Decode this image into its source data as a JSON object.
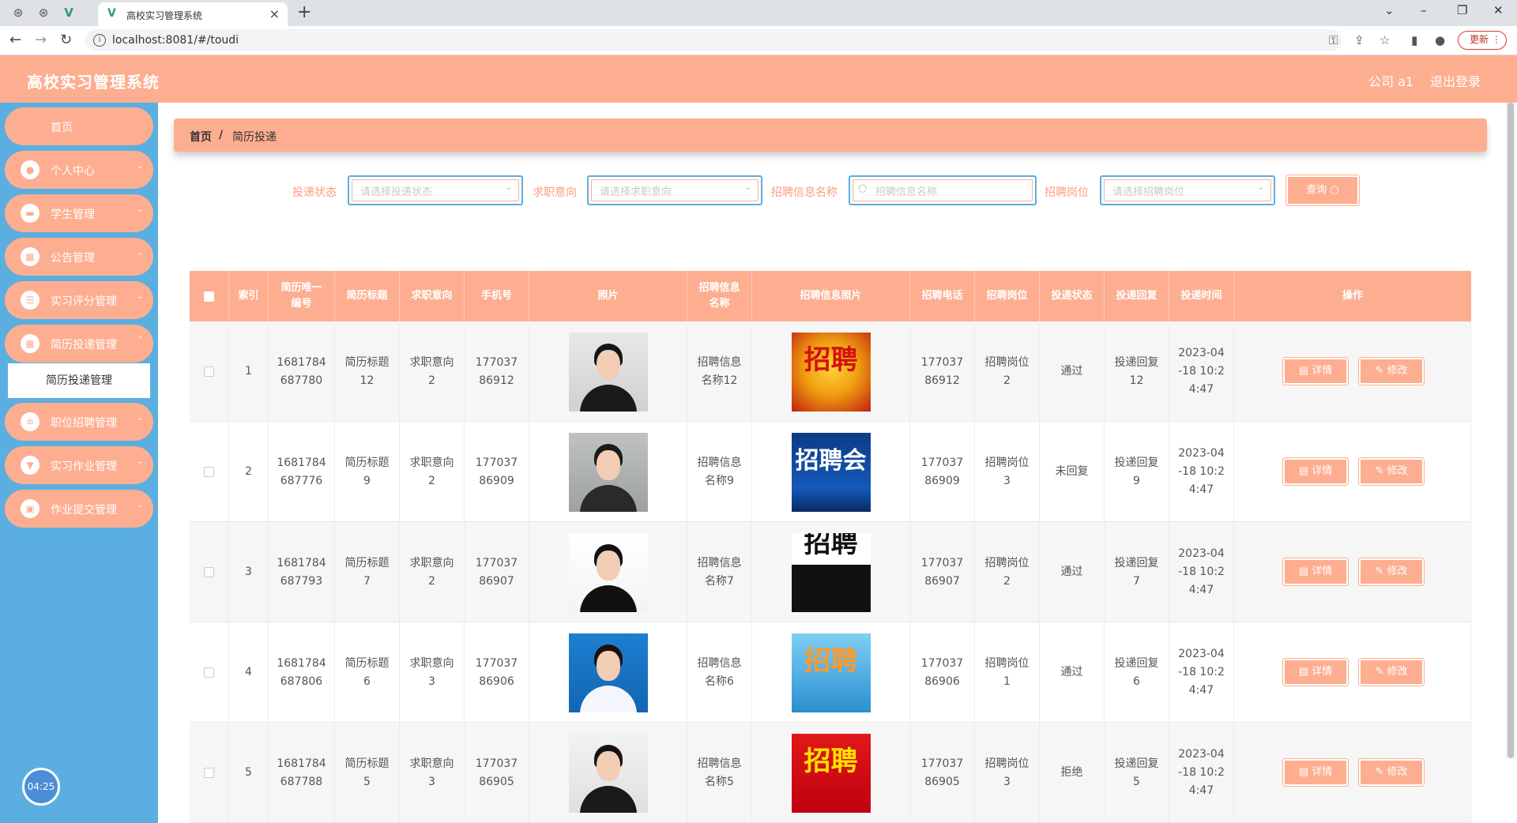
{
  "browser": {
    "tab_title": "高校实习管理系统",
    "url": "localhost:8081/#/toudi",
    "update_label": "更新"
  },
  "header": {
    "title": "高校实习管理系统",
    "user": "公司 a1",
    "logout": "退出登录"
  },
  "sidebar": {
    "items": [
      {
        "label": "首页"
      },
      {
        "label": "个人中心"
      },
      {
        "label": "学生管理"
      },
      {
        "label": "公告管理"
      },
      {
        "label": "实习评分管理"
      },
      {
        "label": "简历投递管理"
      },
      {
        "label": "职位招聘管理"
      },
      {
        "label": "实习作业管理"
      },
      {
        "label": "作业提交管理"
      }
    ],
    "submenu_active": "简历投递管理",
    "timer": "04:25"
  },
  "breadcrumb": {
    "home": "首页",
    "sep": "/",
    "current": "简历投递"
  },
  "filters": {
    "status_label": "投递状态",
    "status_placeholder": "请选择投递状态",
    "intent_label": "求职意向",
    "intent_placeholder": "请选择求职意向",
    "info_label": "招聘信息名称",
    "info_placeholder": "招聘信息名称",
    "post_label": "招聘岗位",
    "post_placeholder": "请选择招聘岗位",
    "query_label": "查询"
  },
  "table": {
    "headers": {
      "index": "索引",
      "resume_no": "简历唯一编号",
      "resume_title": "简历标题",
      "intent": "求职意向",
      "phone": "手机号",
      "photo": "照片",
      "info_name": "招聘信息名称",
      "info_photo": "招聘信息照片",
      "recruit_phone": "招聘电话",
      "post": "招聘岗位",
      "status": "投递状态",
      "reply": "投递回复",
      "time": "投递时间",
      "ops": "操作"
    },
    "detail_label": "详情",
    "edit_label": "修改",
    "rows": [
      {
        "index": "1",
        "resume_no": "1681784687780",
        "resume_title": "简历标题12",
        "intent": "求职意向2",
        "phone": "17703786912",
        "info_name": "招聘信息名称12",
        "recruit_phone": "17703786912",
        "post": "招聘岗位2",
        "status": "通过",
        "reply": "投递回复12",
        "time": "2023-04-18 10:24:47",
        "poster_text": "招聘"
      },
      {
        "index": "2",
        "resume_no": "1681784687776",
        "resume_title": "简历标题9",
        "intent": "求职意向2",
        "phone": "17703786909",
        "info_name": "招聘信息名称9",
        "recruit_phone": "17703786909",
        "post": "招聘岗位3",
        "status": "未回复",
        "reply": "投递回复9",
        "time": "2023-04-18 10:24:47",
        "poster_text": "招聘会"
      },
      {
        "index": "3",
        "resume_no": "1681784687793",
        "resume_title": "简历标题7",
        "intent": "求职意向2",
        "phone": "17703786907",
        "info_name": "招聘信息名称7",
        "recruit_phone": "17703786907",
        "post": "招聘岗位2",
        "status": "通过",
        "reply": "投递回复7",
        "time": "2023-04-18 10:24:47",
        "poster_text": "招聘"
      },
      {
        "index": "4",
        "resume_no": "1681784687806",
        "resume_title": "简历标题6",
        "intent": "求职意向3",
        "phone": "17703786906",
        "info_name": "招聘信息名称6",
        "recruit_phone": "17703786906",
        "post": "招聘岗位1",
        "status": "通过",
        "reply": "投递回复6",
        "time": "2023-04-18 10:24:47",
        "poster_text": "招聘"
      },
      {
        "index": "5",
        "resume_no": "1681784687788",
        "resume_title": "简历标题5",
        "intent": "求职意向3",
        "phone": "17703786905",
        "info_name": "招聘信息名称5",
        "recruit_phone": "17703786905",
        "post": "招聘岗位3",
        "status": "拒绝",
        "reply": "投递回复5",
        "time": "2023-04-18 10:24:47",
        "poster_text": "招聘"
      }
    ]
  },
  "colors": {
    "accent": "#fdae90",
    "sidebar": "#5bafe0"
  }
}
